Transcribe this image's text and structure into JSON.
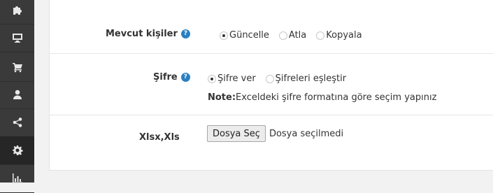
{
  "sidebar": {
    "items": [
      {
        "icon": "puzzle-icon",
        "active": false
      },
      {
        "icon": "monitor-icon",
        "active": false
      },
      {
        "icon": "cart-icon",
        "active": false
      },
      {
        "icon": "user-icon",
        "active": false
      },
      {
        "icon": "share-icon",
        "active": false
      },
      {
        "icon": "gear-icon",
        "active": true
      },
      {
        "icon": "bar-chart-icon",
        "active": false
      }
    ]
  },
  "form": {
    "existing_people": {
      "label": "Mevcut kişiler",
      "help": "?",
      "options": [
        "Güncelle",
        "Atla",
        "Kopyala"
      ],
      "selected": "Güncelle"
    },
    "password": {
      "label": "Şifre",
      "help": "?",
      "options": [
        "Şifre ver",
        "Şifreleri eşleştir"
      ],
      "selected": "Şifre ver",
      "note_label": "Note:",
      "note_text": "Exceldeki şifre formatına göre seçim yapınız"
    },
    "file": {
      "label": "Xlsx,Xls",
      "button": "Dosya Seç",
      "status": "Dosya seçilmedi"
    }
  },
  "colors": {
    "sidebar": "#3a3a3a",
    "help": "#2a7fc1"
  }
}
